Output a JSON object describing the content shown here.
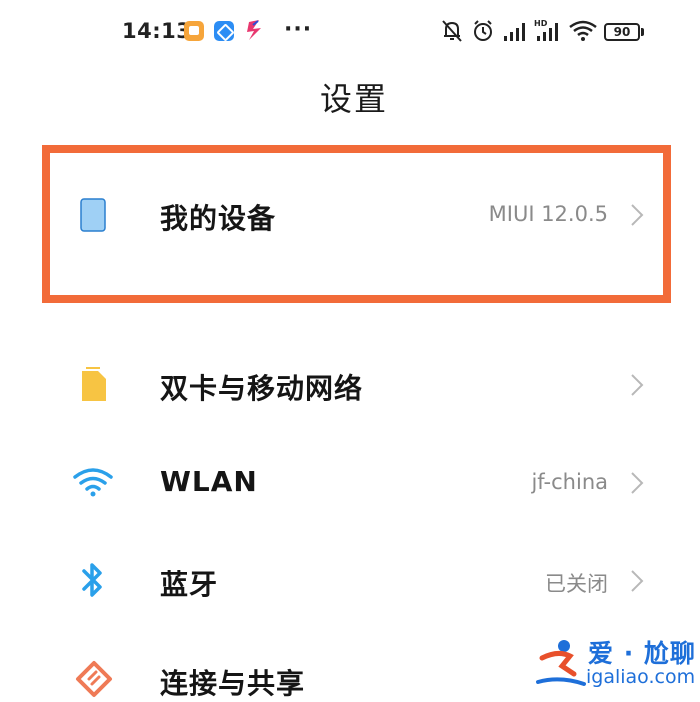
{
  "status_bar": {
    "time": "14:13",
    "more": "···",
    "battery": "90",
    "icons": [
      "notification-app-icon",
      "notification-app-icon",
      "notification-app-icon",
      "mute-icon",
      "alarm-icon",
      "signal-icon",
      "hd-signal-icon",
      "wifi-icon",
      "battery-icon"
    ]
  },
  "header": {
    "title": "设置"
  },
  "rows": [
    {
      "label": "我的设备",
      "value": "MIUI 12.0.5",
      "icon": "device-icon",
      "icon_color": "#8cc4f0"
    },
    {
      "label": "双卡与移动网络",
      "value": "",
      "icon": "sim-card-icon",
      "icon_color": "#f7c443"
    },
    {
      "label": "WLAN",
      "value": "jf-china",
      "icon": "wifi-icon",
      "icon_color": "#2aa0ea"
    },
    {
      "label": "蓝牙",
      "value": "已关闭",
      "icon": "bluetooth-icon",
      "icon_color": "#2aa0ea"
    },
    {
      "label": "连接与共享",
      "value": "",
      "icon": "connection-share-icon",
      "icon_color": "#ef7a56"
    }
  ],
  "highlight_color": "#f26b39",
  "watermark": {
    "top": "爱 · 尬聊",
    "bottom": "igaliao.com"
  }
}
